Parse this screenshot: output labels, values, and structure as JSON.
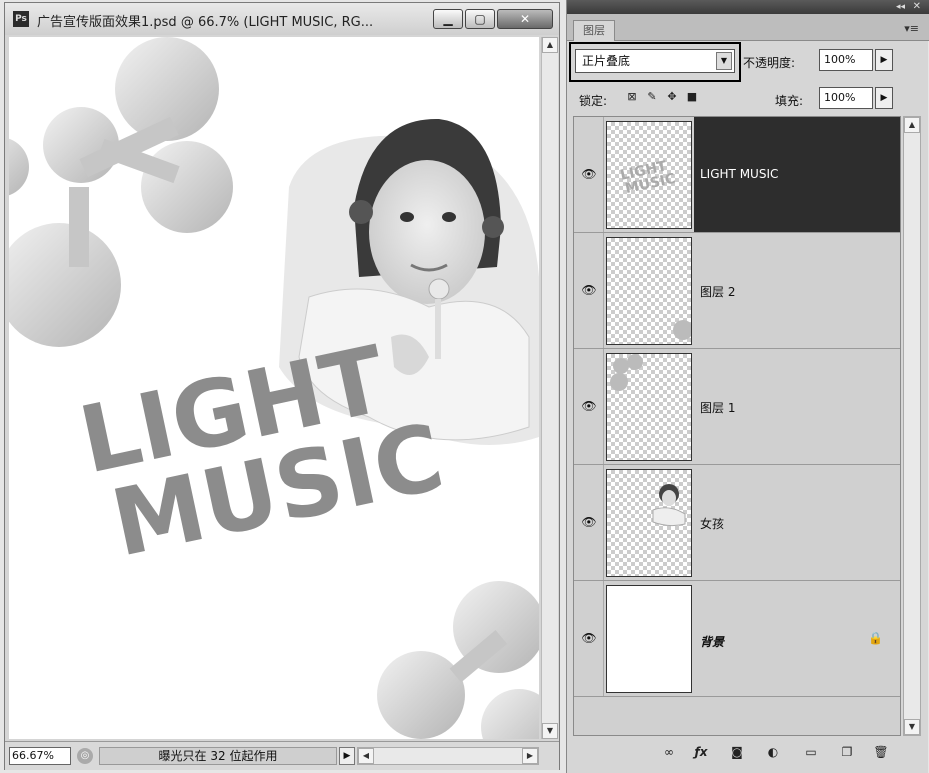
{
  "document": {
    "title": "广告宣传版面效果1.psd @ 66.7% (LIGHT MUSIC, RG...",
    "app_icon": "Ps",
    "canvas_text": [
      "LIGHT",
      "MUSIC"
    ],
    "status": {
      "zoom": "66.67%",
      "message": "曝光只在 32 位起作用"
    }
  },
  "panel": {
    "tab": "图层",
    "blend_mode": "正片叠底",
    "opacity_label": "不透明度:",
    "opacity_value": "100%",
    "lock_label": "锁定:",
    "fill_label": "填充:",
    "fill_value": "100%",
    "layers": [
      {
        "name": "LIGHT MUSIC",
        "selected": true,
        "thumb": "text"
      },
      {
        "name": "图层 2",
        "selected": false,
        "thumb": "transparent"
      },
      {
        "name": "图层 1",
        "selected": false,
        "thumb": "transparent"
      },
      {
        "name": "女孩",
        "selected": false,
        "thumb": "girl"
      },
      {
        "name": "背景",
        "selected": false,
        "thumb": "white",
        "locked": true
      }
    ],
    "thumb_text": [
      "LIGHT",
      "MUSIC"
    ]
  },
  "colors": {
    "selected_row": "#2d2d2d",
    "canvas_gray": "#8c8c8c"
  }
}
